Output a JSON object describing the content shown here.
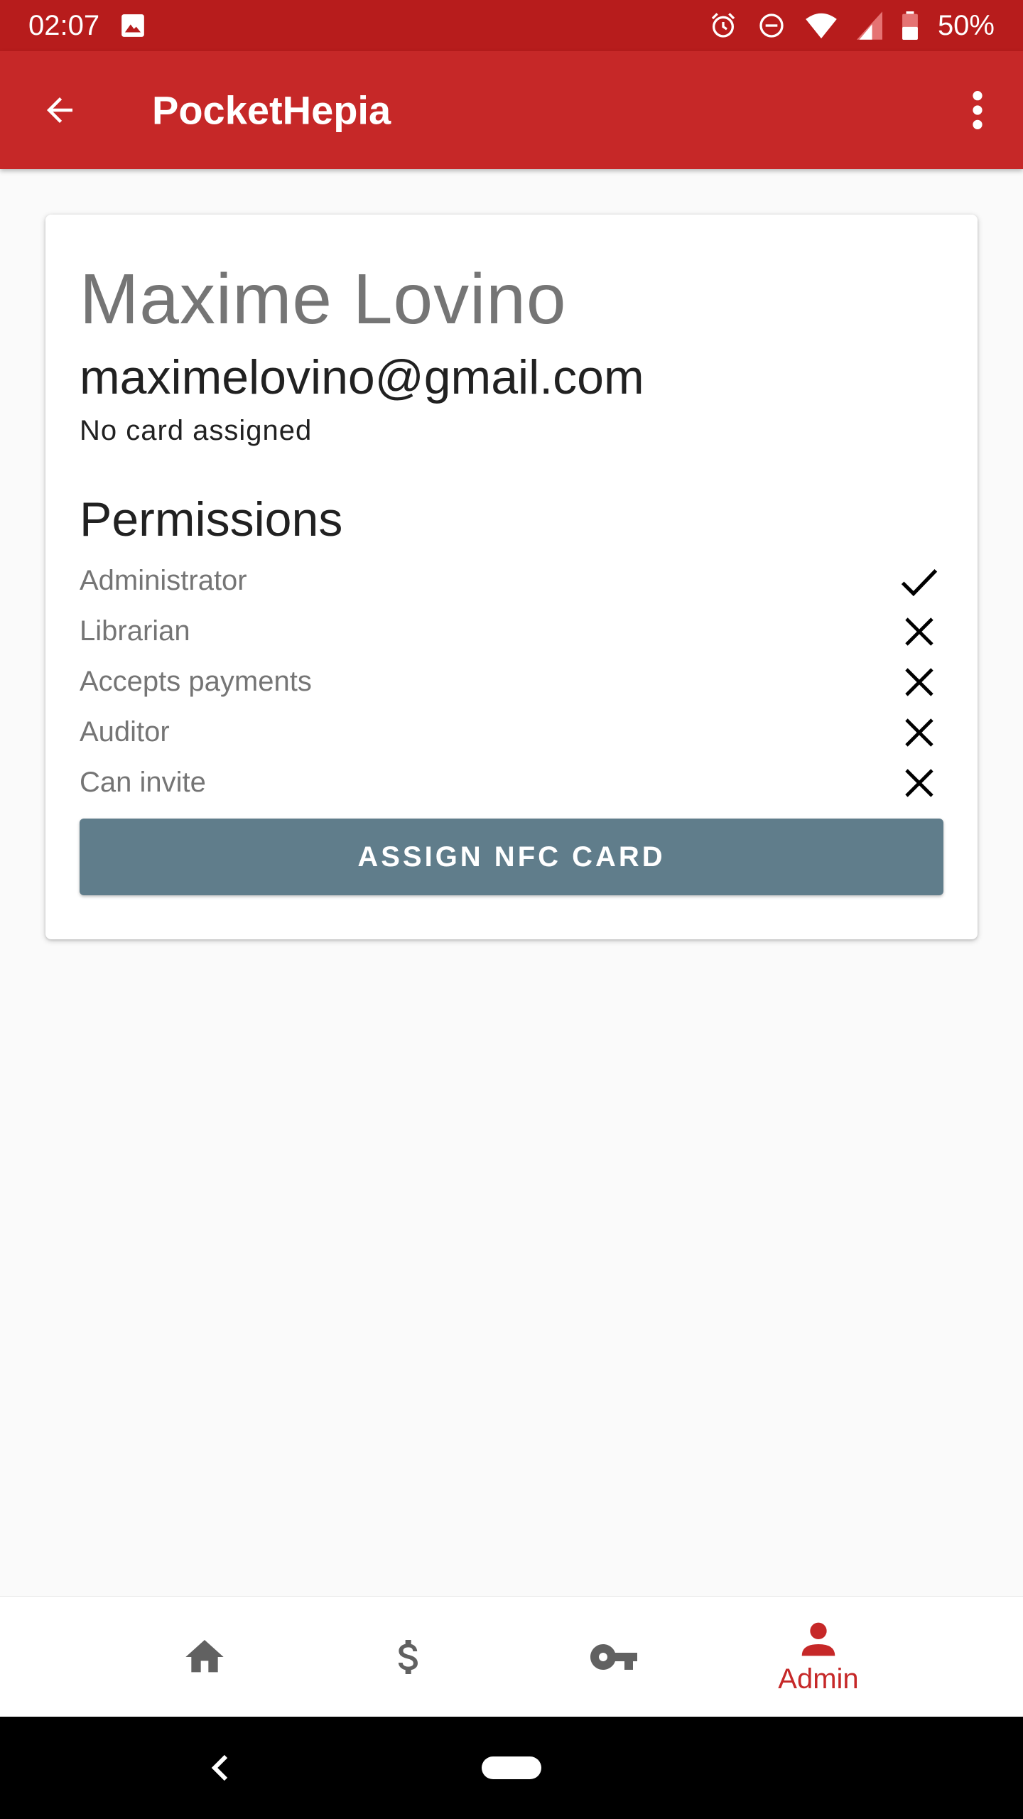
{
  "status_bar": {
    "time": "02:07",
    "battery": "50%",
    "color": "#b71c1c"
  },
  "app_bar": {
    "title": "PocketHepia",
    "color": "#c62828"
  },
  "user": {
    "name": "Maxime Lovino",
    "email": "maximelovino@gmail.com",
    "card_status": "No card assigned"
  },
  "permissions": {
    "heading": "Permissions",
    "items": [
      {
        "label": "Administrator",
        "granted": true
      },
      {
        "label": "Librarian",
        "granted": false
      },
      {
        "label": "Accepts payments",
        "granted": false
      },
      {
        "label": "Auditor",
        "granted": false
      },
      {
        "label": "Can invite",
        "granted": false
      }
    ]
  },
  "actions": {
    "assign_label": "ASSIGN NFC CARD",
    "button_color": "#607d8b"
  },
  "bottom_nav": {
    "items": [
      {
        "icon": "home-icon",
        "label": "",
        "active": false
      },
      {
        "icon": "dollar-icon",
        "label": "",
        "active": false
      },
      {
        "icon": "key-icon",
        "label": "",
        "active": false
      },
      {
        "icon": "person-icon",
        "label": "Admin",
        "active": true
      }
    ],
    "active_color": "#c62828",
    "inactive_color": "#616161"
  }
}
